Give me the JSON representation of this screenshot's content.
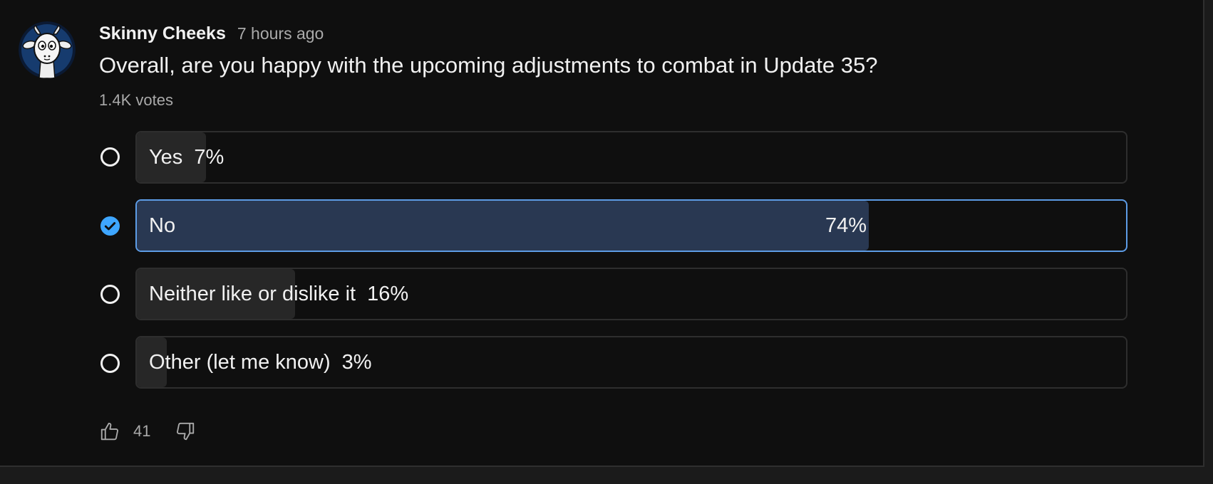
{
  "post": {
    "author": "Skinny Cheeks",
    "time": "7 hours ago",
    "question": "Overall, are you happy with the upcoming adjustments to combat in Update 35?",
    "votes": "1.4K votes"
  },
  "poll": {
    "options": [
      {
        "label": "Yes",
        "percent_text": "7%",
        "percent": 7,
        "selected": false
      },
      {
        "label": "No",
        "percent_text": "74%",
        "percent": 74,
        "selected": true
      },
      {
        "label": "Neither like or dislike it",
        "percent_text": "16%",
        "percent": 16,
        "selected": false
      },
      {
        "label": "Other (let me know)",
        "percent_text": "3%",
        "percent": 3,
        "selected": false
      }
    ]
  },
  "actions": {
    "like_count": "41"
  },
  "colors": {
    "background": "#0f0f0f",
    "text": "#f1f1f1",
    "muted_text": "#aaaaaa",
    "bar_fill": "#272727",
    "selected_fill": "#293852",
    "selected_border": "#5d9ce6",
    "check": "#3ea6ff"
  },
  "icons": {
    "avatar": "goat-avatar",
    "radio": "radio-unchecked-icon",
    "check": "check-circle-icon",
    "like": "thumb-up-icon",
    "dislike": "thumb-down-icon"
  }
}
